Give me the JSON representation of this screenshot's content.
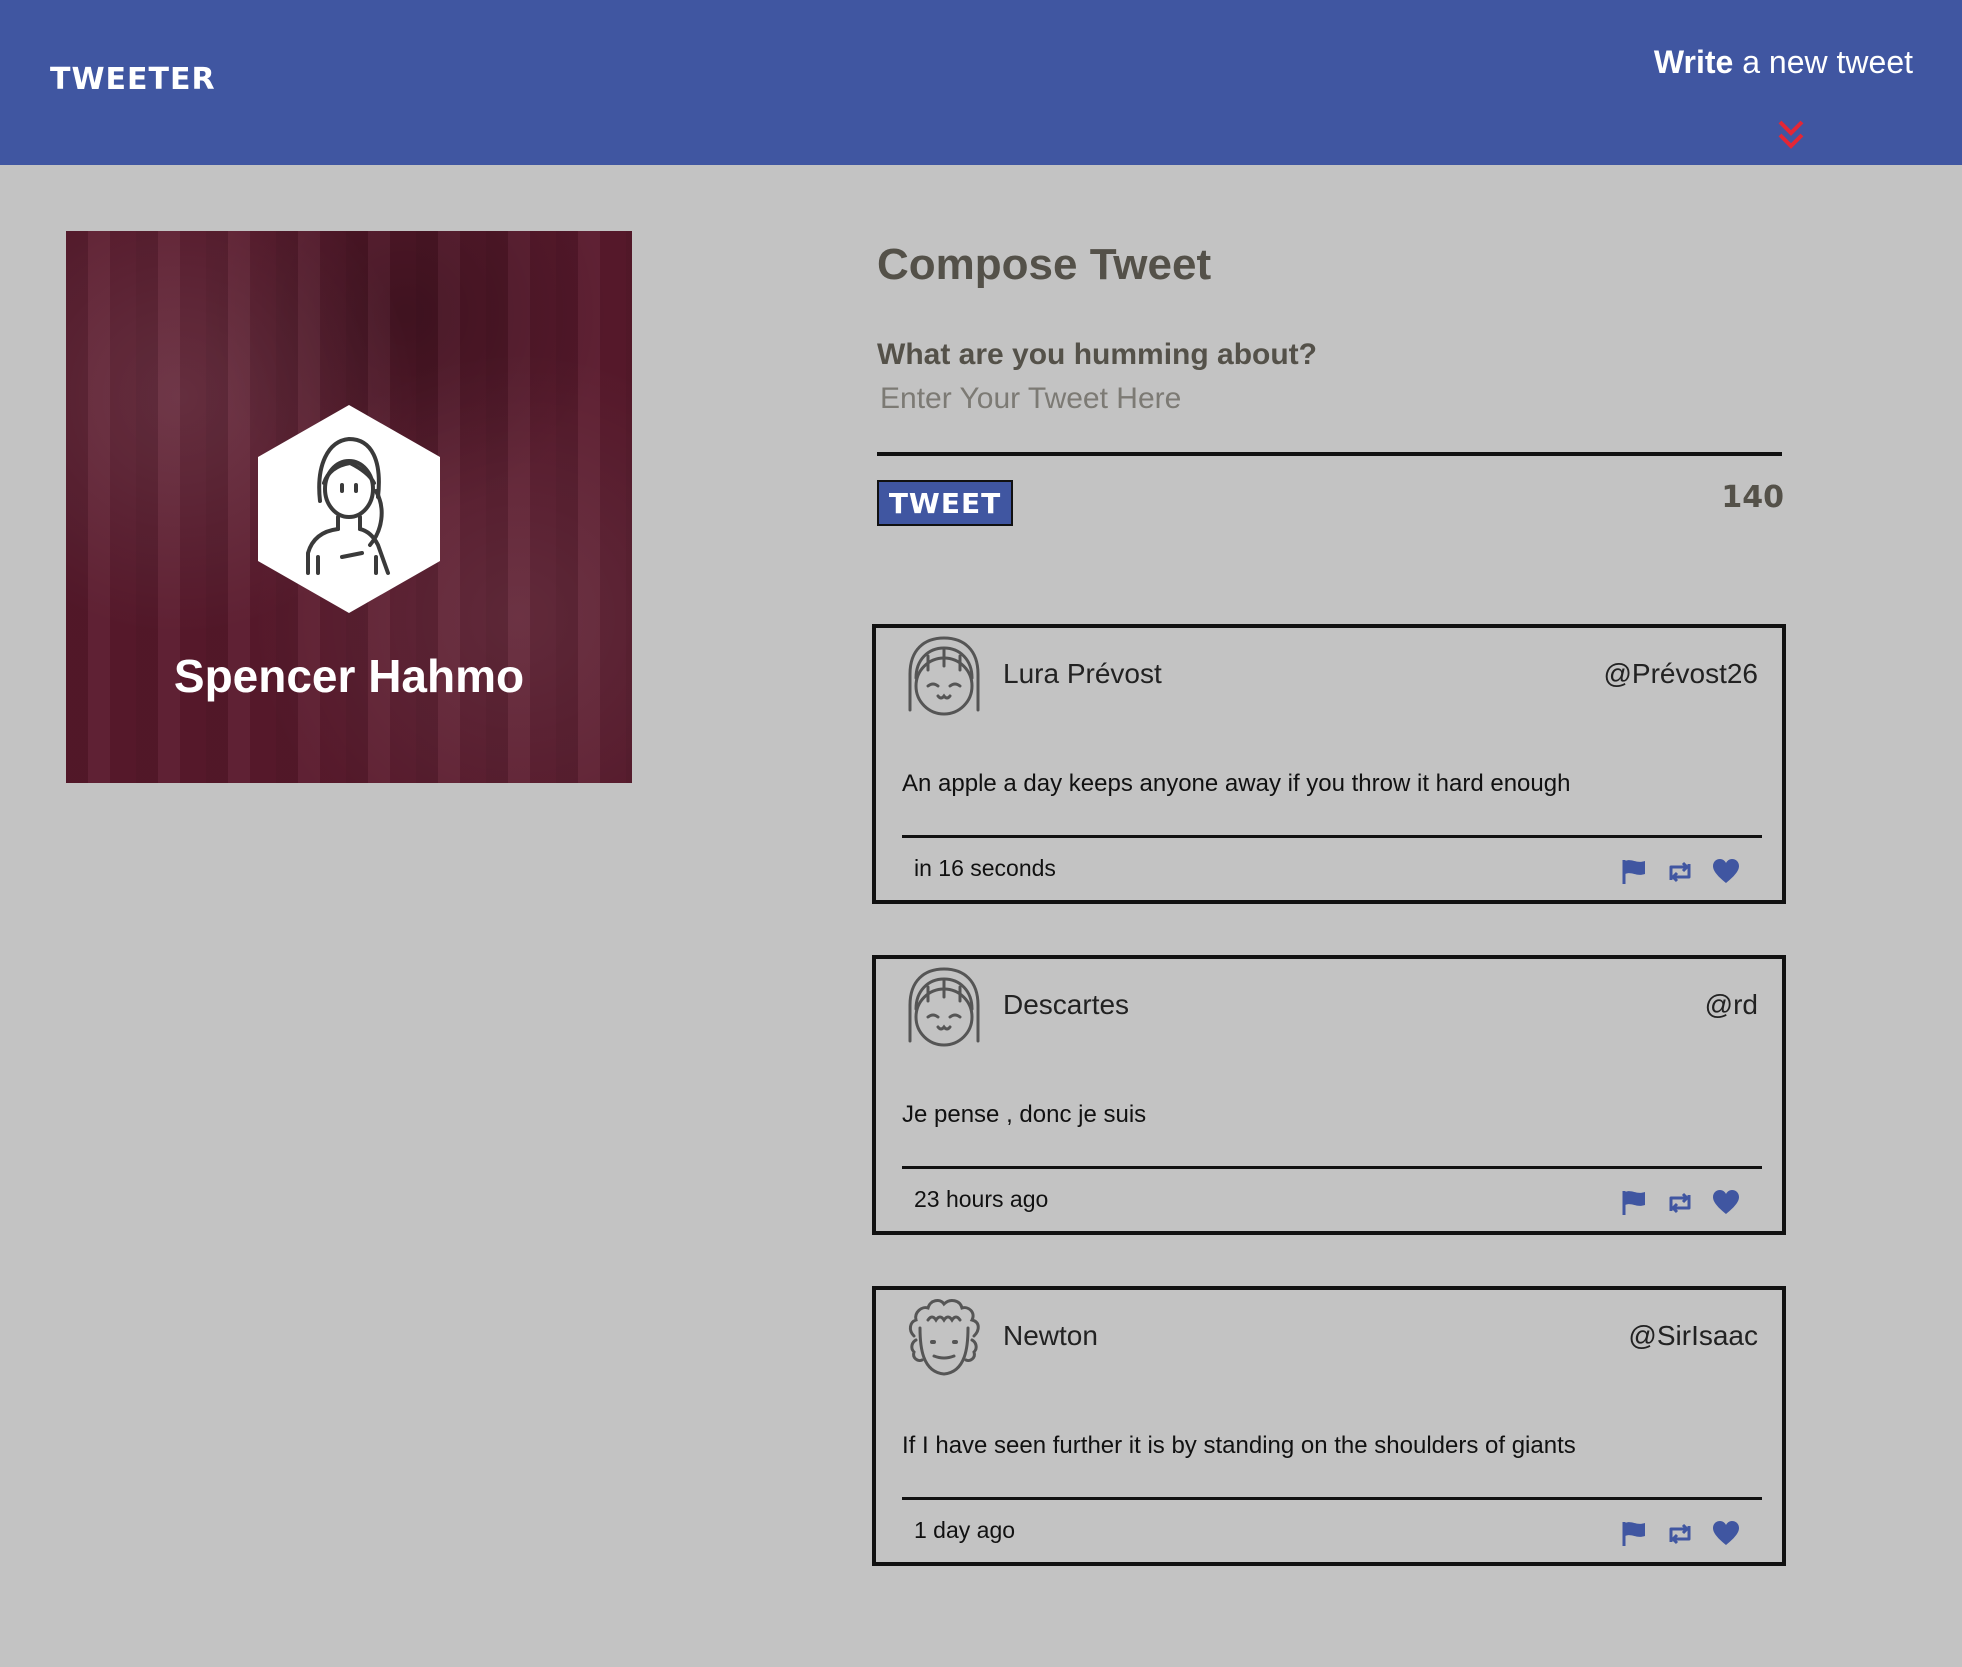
{
  "header": {
    "brand": "TWEETER",
    "write_bold": "Write",
    "write_rest": " a new tweet",
    "accent_color": "#4056a1",
    "chevron_color": "#e32636"
  },
  "profile": {
    "name": "Spencer Hahmo",
    "avatar_icon": "woman-avatar-icon"
  },
  "compose": {
    "title": "Compose Tweet",
    "question": "What are you humming about?",
    "placeholder": "Enter Your Tweet Here",
    "button_label": "TWEET",
    "counter": "140"
  },
  "tweets": [
    {
      "name": "Lura Prévost",
      "handle": "@Prévost26",
      "text": "An apple a day keeps anyone away if you throw it hard enough",
      "time": "in 16 seconds",
      "avatar_icon": "girl-avatar-icon"
    },
    {
      "name": "Descartes",
      "handle": "@rd",
      "text": "Je pense , donc je suis",
      "time": "23 hours ago",
      "avatar_icon": "girl-avatar-icon"
    },
    {
      "name": "Newton",
      "handle": "@SirIsaac",
      "text": "If I have seen further it is by standing on the shoulders of giants",
      "time": "1 day ago",
      "avatar_icon": "curly-hair-avatar-icon"
    }
  ],
  "action_icons": [
    "flag-icon",
    "retweet-icon",
    "heart-icon"
  ]
}
